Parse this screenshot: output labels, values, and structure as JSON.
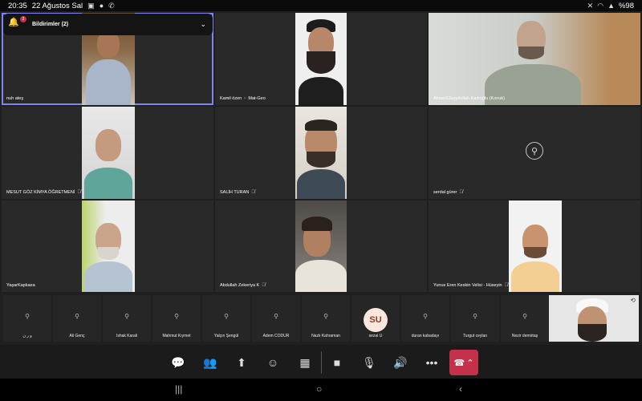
{
  "status_bar": {
    "time": "20:35",
    "date": "22 Ağustos Sal",
    "battery": "%98"
  },
  "notification": {
    "title": "Bildirimler (2)",
    "badge": "2"
  },
  "participants": [
    "nuh ateş",
    "Kamil özen",
    "Mat-Geo",
    "Ahmet/Ubeydullah Kadıoğlu (Konuk)",
    "MESUT GÖZ KİMYA ÖĞRETMENİ",
    "SALİH TURAN",
    "serdal gürer",
    "YaşarKapkaea",
    "Abdullah Zekeriya K",
    "Yunus Eren Keskin Velisi - Hüseyin"
  ],
  "strip": [
    {
      "name": "و ر ن"
    },
    {
      "name": "Ali Genç"
    },
    {
      "name": "İshak Karali"
    },
    {
      "name": "Mahmut Kıymet"
    },
    {
      "name": "Yalçın Şengül"
    },
    {
      "name": "Adem CODUR"
    },
    {
      "name": "Nazlı Kahraman"
    },
    {
      "name": "sezai U",
      "initials": "SU"
    },
    {
      "name": "duran kabadayı"
    },
    {
      "name": "Turgut ceylan"
    },
    {
      "name": "Nezir demirtaş"
    }
  ],
  "icons": {
    "mic_off": "mic-off-icon",
    "avatar": "person-icon",
    "chat": "chat-icon",
    "people": "people-icon",
    "share": "share-screen-icon",
    "reactions": "reactions-icon",
    "more_apps": "apps-grid-icon",
    "camera": "camera-icon",
    "mic": "mic-icon",
    "speaker": "speaker-icon",
    "more": "more-icon",
    "hangup": "hangup-icon"
  },
  "colors": {
    "accent": "#7f85f5",
    "hangup": "#c4314b",
    "su_avatar_bg": "#fbe7dd"
  }
}
